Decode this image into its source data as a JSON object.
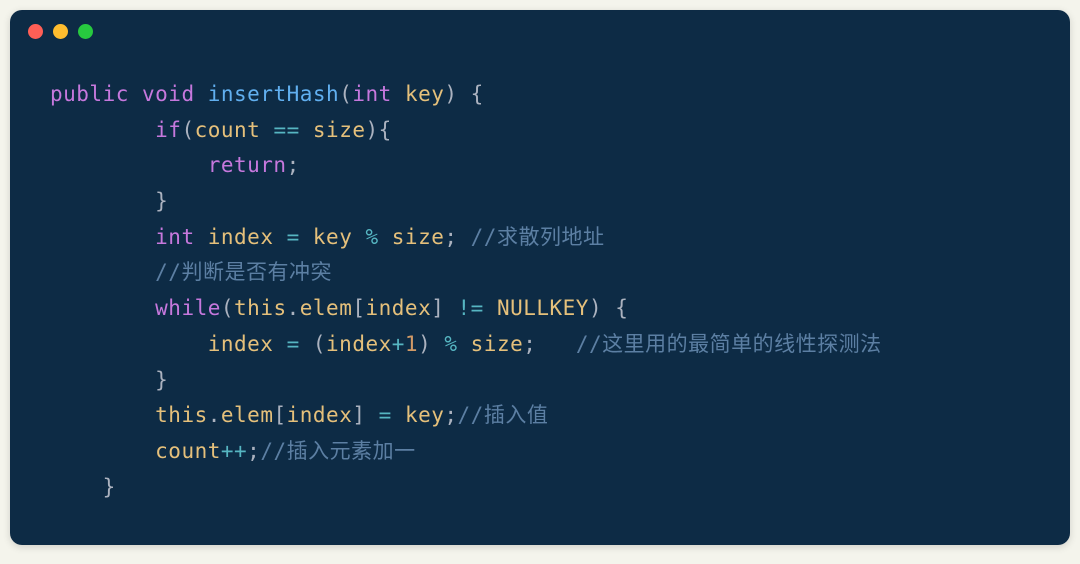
{
  "code": {
    "line1": {
      "public": "public",
      "void": "void",
      "fn": "insertHash",
      "lparen": "(",
      "int": "int",
      "key": "key",
      "rparen_brace": ") {"
    },
    "line2": {
      "indent": "        ",
      "if": "if",
      "lparen": "(",
      "count": "count",
      "eq": " == ",
      "size": "size",
      "rparen_brace": "){"
    },
    "line3": {
      "indent": "            ",
      "return": "return",
      "semi": ";"
    },
    "line4": {
      "indent": "        ",
      "brace": "}"
    },
    "line5": {
      "indent": "        ",
      "int": "int",
      "index": "index",
      "eq": " = ",
      "key": "key",
      "mod": " % ",
      "size": "size",
      "semi": "; ",
      "comment": "//求散列地址"
    },
    "line6": {
      "indent": "        ",
      "comment": "//判断是否有冲突"
    },
    "line7": {
      "indent": "        ",
      "while": "while",
      "lparen": "(",
      "this": "this",
      "dot": ".",
      "elem": "elem",
      "lbrace": "[",
      "index": "index",
      "rbrace": "]",
      "neq": " != ",
      "nullkey": "NULLKEY",
      "rparen_brace": ") {"
    },
    "line8": {
      "indent": "            ",
      "index": "index",
      "eq": " = ",
      "lparen": "(",
      "index2": "index",
      "plus": "+",
      "one": "1",
      "rparen": ")",
      "mod": " % ",
      "size": "size",
      "semi": ";   ",
      "comment": "//这里用的最简单的线性探测法"
    },
    "line9": {
      "indent": "        ",
      "brace": "}"
    },
    "line10": {
      "indent": "        ",
      "this": "this",
      "dot": ".",
      "elem": "elem",
      "lbrace": "[",
      "index": "index",
      "rbrace": "]",
      "eq": " = ",
      "key": "key",
      "semi": ";",
      "comment": "//插入值"
    },
    "line11": {
      "indent": "        ",
      "count": "count",
      "pp": "++",
      "semi": ";",
      "comment": "//插入元素加一"
    },
    "line12": {
      "indent": "    ",
      "brace": "}"
    }
  }
}
